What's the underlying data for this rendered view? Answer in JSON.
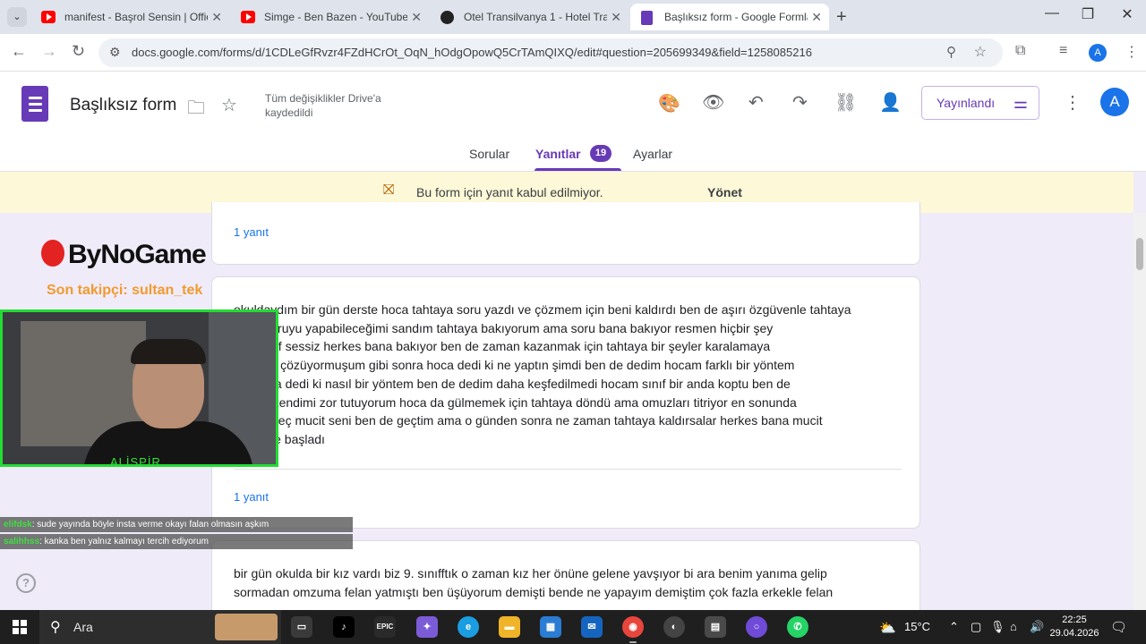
{
  "browser": {
    "tabs": [
      {
        "title": "manifest - Başrol Sensin | Offici",
        "favicon": "youtube-icon"
      },
      {
        "title": "Simge - Ben Bazen - YouTube",
        "favicon": "youtube-icon"
      },
      {
        "title": "Otel Transilvanya 1 - Hotel Tran",
        "favicon": "otel-icon"
      },
      {
        "title": "Başlıksız form - Google Formlar",
        "favicon": "google-forms-icon"
      }
    ],
    "url": "docs.google.com/forms/d/1CDLeGfRvzr4FZdHCrOt_OqN_hOdgOpowQ5CrTAmQIXQ/edit#question=205699349&field=1258085216",
    "profile_initial": "A"
  },
  "form": {
    "title": "Başlıksız form",
    "save_status": "Tüm değişiklikler Drive'a kaydedildi",
    "publish_label": "Yayınlandı",
    "avatar_initial": "A",
    "tabs": {
      "questions": "Sorular",
      "responses": "Yanıtlar",
      "responses_count": "19",
      "settings": "Ayarlar"
    },
    "banner": {
      "text": "Bu form için yanıt kabul edilmiyor.",
      "action": "Yönet"
    },
    "accent": "#673ab7"
  },
  "responses": {
    "card_a": {
      "reply_count": "1 yanıt"
    },
    "card_b": {
      "lines": [
        "okulda̲ydım bir gün derste hoca tahtaya soru yazdı ve çözmem için beni kaldırdı ben de aşırı özgüvenle tahtaya",
        "ünkü soruyu yapabileceğimi sandım tahtaya bakıyorum ama soru bana bakıyor resmen hiçbir şey",
        "dım sınıf sessiz herkes bana bakıyor ben de zaman kazanmak için tahtaya bir şeyler karalamaya",
        "m sanki çözüyormuşum gibi sonra hoca dedi ki ne yaptın şimdi ben de dedim hocam farklı bir yöntem",
        "um hoca dedi ki nasıl bir yöntem ben de dedim daha keşfedilmedi hocam sınıf bir anda koptu ben de",
        "ek için kendimi zor tutuyorum hoca da gülmemek için tahtaya döndü ama omuzları titriyor en sonunda",
        "yerine geç mucit seni ben de geçtim ama o günden sonra ne zaman tahtaya kaldırsalar herkes bana mucit",
        "lenmeye başladı"
      ],
      "reply_count": "1 yanıt"
    },
    "card_c": {
      "lines": [
        "bir gün okulda bir kız vardı biz 9. sınıfftık o zaman kız her önüne gelene yavşıyor bi ara benim yanıma gelip",
        "sormadan omzuma felan yatmıştı ben üşüyorum demişti bende ne yapayım demiştim çok fazla erkekle felan"
      ]
    }
  },
  "overlay": {
    "brand": "ByNoGame",
    "last_follower": "Son takipçi: sultan_tek",
    "cam_name": "ALİSPİR",
    "chat": [
      {
        "user": "elifdsk",
        "text": ": sude yayında böyle insta verme okayı falan olmasın aşkım"
      },
      {
        "user": "salihhss",
        "text": ": kanka ben yalnız kalmayı tercih ediyorum"
      }
    ]
  },
  "taskbar": {
    "search_label": "Ara",
    "weather": "15°C",
    "time": "22:25",
    "date": "29.04.2026"
  }
}
